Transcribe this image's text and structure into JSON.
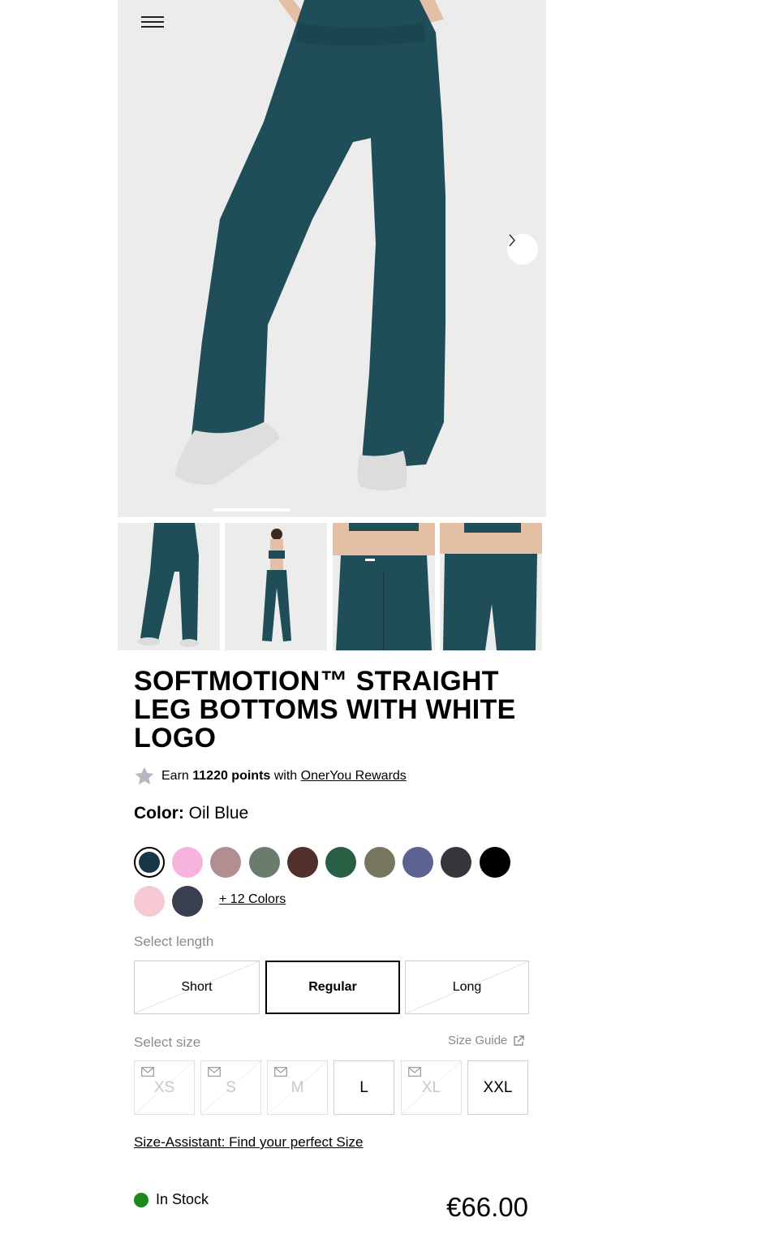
{
  "product": {
    "title": "SOFTMOTION™ STRAIGHT LEG BOTTOMS WITH WHITE LOGO",
    "rewards": {
      "prefix": "Earn",
      "points": "11220 points",
      "middle": "with",
      "link": "OnerYou Rewards"
    },
    "color_label": "Color:",
    "color_value": "Oil Blue",
    "swatches": [
      "#173844",
      "#f6b3dc",
      "#b18f90",
      "#6a7c6c",
      "#512f2a",
      "#295f45",
      "#77775f",
      "#5c6291",
      "#34363c",
      "#000000",
      "#f7c9d2",
      "#38404f"
    ],
    "more_colors": "+ 12 Colors",
    "length_label": "Select length",
    "lengths": [
      "Short",
      "Regular",
      "Long"
    ],
    "selected_length": "Regular",
    "size_label": "Select size",
    "size_guide": "Size Guide",
    "sizes": [
      "XS",
      "S",
      "M",
      "L",
      "XL",
      "XXL"
    ],
    "size_assistant": "Size-Assistant: Find your perfect Size",
    "stock": "In Stock",
    "stock_color": "#1a8a1a",
    "price": "€66.00"
  },
  "icons": {
    "menu": "hamburger-icon",
    "next": "chevron-right-icon",
    "star": "star-icon",
    "external": "external-link-icon",
    "mail": "mail-icon"
  }
}
